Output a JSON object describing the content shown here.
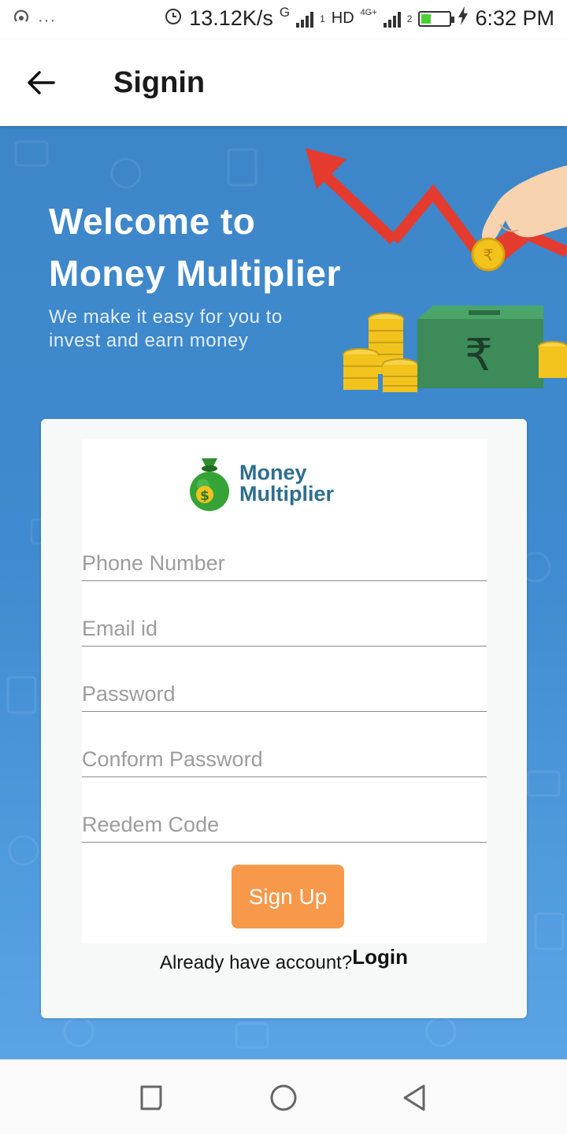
{
  "status_bar": {
    "net_speed": "13.12K/s",
    "net_type_1": "G",
    "sim_1": "1",
    "hd_label": "HD",
    "net_type_2": "4G+",
    "sim_2": "2",
    "time": "6:32 PM",
    "battery_level": 0.35,
    "battery_color": "#4cd137",
    "icons": [
      "hotspot-icon",
      "more-dots-icon",
      "alarm-icon",
      "signal-icon",
      "battery-icon",
      "charging-icon"
    ]
  },
  "app_bar": {
    "title": "Signin",
    "back_icon": "arrow-left-icon"
  },
  "banner": {
    "title_line1": "Welcome to",
    "title_line2": "Money Multiplier",
    "subtitle_line1": "We make it easy for you to",
    "subtitle_line2": "invest and earn money",
    "rupee_symbol": "₹"
  },
  "form": {
    "logo_line1": "Money",
    "logo_line2": "Multiplier",
    "logo_icon": "money-bag-icon",
    "phone_placeholder": "Phone Number",
    "email_placeholder": "Email id",
    "password_placeholder": "Password",
    "confirm_password_placeholder": "Conform Password",
    "redeem_placeholder": "Reedem Code",
    "signup_label": "Sign Up",
    "already_text": "Already have account?",
    "login_label": "Login"
  },
  "colors": {
    "accent": "#f7984a",
    "background": "#3f8ad0",
    "logo_text": "#2e6e8e"
  },
  "nav_bar": {
    "icons": [
      "recents-square-icon",
      "home-circle-icon",
      "back-triangle-icon"
    ]
  }
}
